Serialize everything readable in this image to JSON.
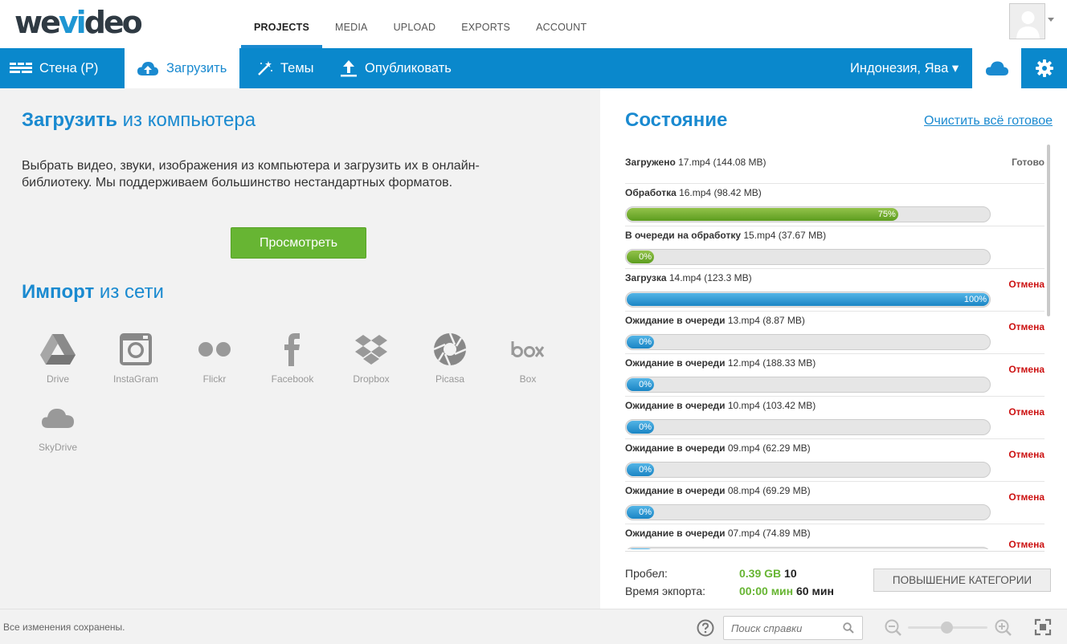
{
  "brand": {
    "logo_left": "we",
    "logo_mid": "vi",
    "logo_right": "deo"
  },
  "topnav": [
    {
      "label": "PROJECTS",
      "active": true
    },
    {
      "label": "MEDIA"
    },
    {
      "label": "UPLOAD"
    },
    {
      "label": "EXPORTS"
    },
    {
      "label": "ACCOUNT"
    }
  ],
  "menubar": {
    "wall": "Стена (P)",
    "upload": "Загрузить",
    "themes": "Темы",
    "publish": "Опубликовать",
    "location": "Индонезия, Ява ▾"
  },
  "upload_panel": {
    "title_strong": "Загрузить",
    "title_rest": " из компьютера",
    "description": "Выбрать видео, звуки, изображения из компьютера и загрузить их в онлайн-библиотеку. Мы поддерживаем большинство нестандартных форматов.",
    "browse_button": "Просмотреть",
    "import_strong": "Импорт",
    "import_rest": " из сети",
    "services": [
      {
        "label": "Drive",
        "icon": "google-drive-icon"
      },
      {
        "label": "InstaGram",
        "icon": "instagram-icon"
      },
      {
        "label": "Flickr",
        "icon": "flickr-icon"
      },
      {
        "label": "Facebook",
        "icon": "facebook-icon"
      },
      {
        "label": "Dropbox",
        "icon": "dropbox-icon"
      },
      {
        "label": "Picasa",
        "icon": "picasa-icon"
      },
      {
        "label": "Box",
        "icon": "box-icon"
      },
      {
        "label": "SkyDrive",
        "icon": "skydrive-icon"
      }
    ]
  },
  "status_panel": {
    "title": "Состояние",
    "clear_link": "Очистить всё готовое",
    "items": [
      {
        "state": "Загружено",
        "file": " 17.mp4 (144.08 MB)",
        "status": "Готово",
        "progress": null,
        "pct": ""
      },
      {
        "state": "Обработка",
        "file": " 16.mp4 (98.42 MB)",
        "status": "",
        "progress": 75,
        "pct": "75%",
        "color": "green"
      },
      {
        "state": "В очереди на обработку",
        "file": " 15.mp4 (37.67 MB)",
        "status": "",
        "progress": 0,
        "pct": "0%",
        "color": "green"
      },
      {
        "state": "Загрузка",
        "file": " 14.mp4 (123.3 MB)",
        "status": "Отмена",
        "progress": 100,
        "pct": "100%",
        "color": "blue"
      },
      {
        "state": "Ожидание в очереди",
        "file": " 13.mp4 (8.87 MB)",
        "status": "Отмена",
        "progress": 0,
        "pct": "0%",
        "color": "blue"
      },
      {
        "state": "Ожидание в очереди",
        "file": " 12.mp4 (188.33 MB)",
        "status": "Отмена",
        "progress": 0,
        "pct": "0%",
        "color": "blue"
      },
      {
        "state": "Ожидание в очереди",
        "file": " 10.mp4 (103.42 MB)",
        "status": "Отмена",
        "progress": 0,
        "pct": "0%",
        "color": "blue"
      },
      {
        "state": "Ожидание в очереди",
        "file": " 09.mp4 (62.29 MB)",
        "status": "Отмена",
        "progress": 0,
        "pct": "0%",
        "color": "blue"
      },
      {
        "state": "Ожидание в очереди",
        "file": " 08.mp4 (69.29 MB)",
        "status": "Отмена",
        "progress": 0,
        "pct": "0%",
        "color": "blue"
      },
      {
        "state": "Ожидание в очереди",
        "file": " 07.mp4 (74.89 MB)",
        "status": "Отмена",
        "progress": 0,
        "pct": "",
        "color": "blue"
      }
    ],
    "footer": {
      "space_label": "Пробел:",
      "space_used": "0.39 GB",
      "space_total": " 10",
      "export_label": "Время экпорта:",
      "export_used": "00:00 мин",
      "export_total": " 60 мин",
      "upgrade_button": "ПОВЫШЕНИЕ КАТЕГОРИИ"
    }
  },
  "statusbar": {
    "saved": "Все изменения сохранены.",
    "help_placeholder": "Поиск справки"
  },
  "colors": {
    "accent": "#0a88cc",
    "green": "#67b533",
    "cancel": "#cc1111"
  }
}
